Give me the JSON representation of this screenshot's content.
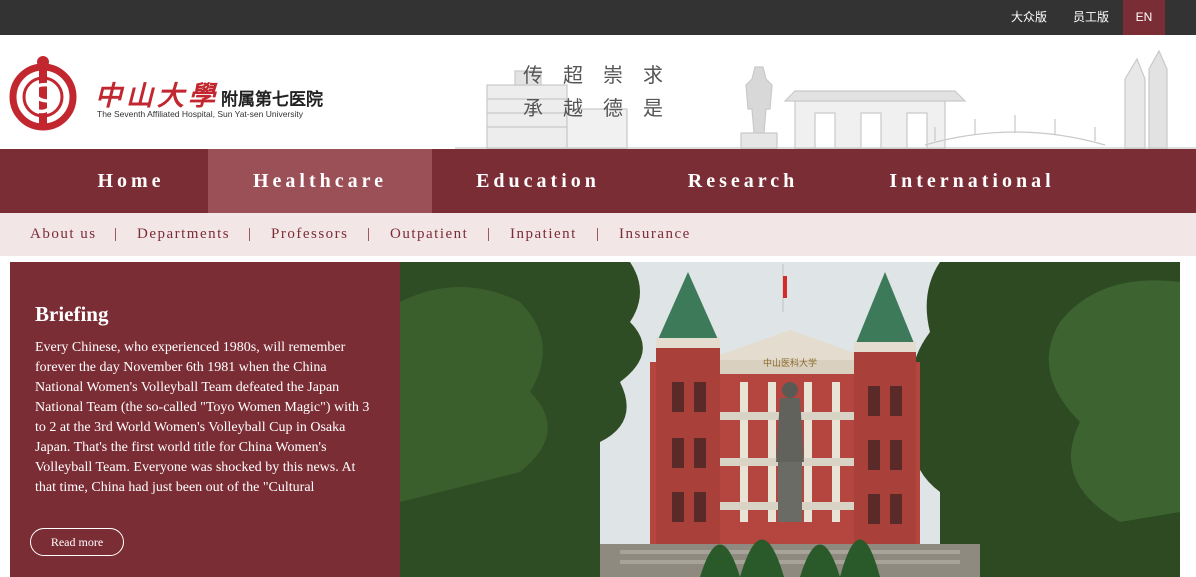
{
  "topbar": {
    "public_version": "大众版",
    "staff_version": "员工版",
    "english": "EN"
  },
  "header": {
    "logo_cn_main": "中山大學",
    "logo_cn_sub": "附属第七医院",
    "logo_en": "The Seventh Affiliated Hospital, Sun Yat-sen University",
    "motto_line1": "传超崇求",
    "motto_line2": "承越德是"
  },
  "main_nav": [
    "Home",
    "Healthcare",
    "Education",
    "Research",
    "International"
  ],
  "sub_nav": [
    "About us",
    "Departments",
    "Professors",
    "Outpatient",
    "Inpatient",
    "Insurance"
  ],
  "sub_nav_separator": "|",
  "briefing": {
    "title": "Briefing",
    "text": "Every Chinese, who experienced 1980s, will remember forever the day November 6th 1981 when the China National Women's Volleyball Team defeated the Japan National Team (the so-called \"Toyo Women Magic\") with 3 to 2 at the 3rd World Women's Volleyball Cup in Osaka Japan. That's the first world title for China Women's Volleyball Team. Everyone was shocked by this news. At that time, China had just been out of the \"Cultural",
    "read_more": "Read more"
  },
  "photo": {
    "building_sign": "中山医科大学"
  },
  "colors": {
    "brand": "#7b2d35",
    "brand_active": "#9b5057",
    "subnav_bg": "#f3e6e7",
    "topbar_bg": "#333333",
    "logo_red": "#c2272f"
  }
}
